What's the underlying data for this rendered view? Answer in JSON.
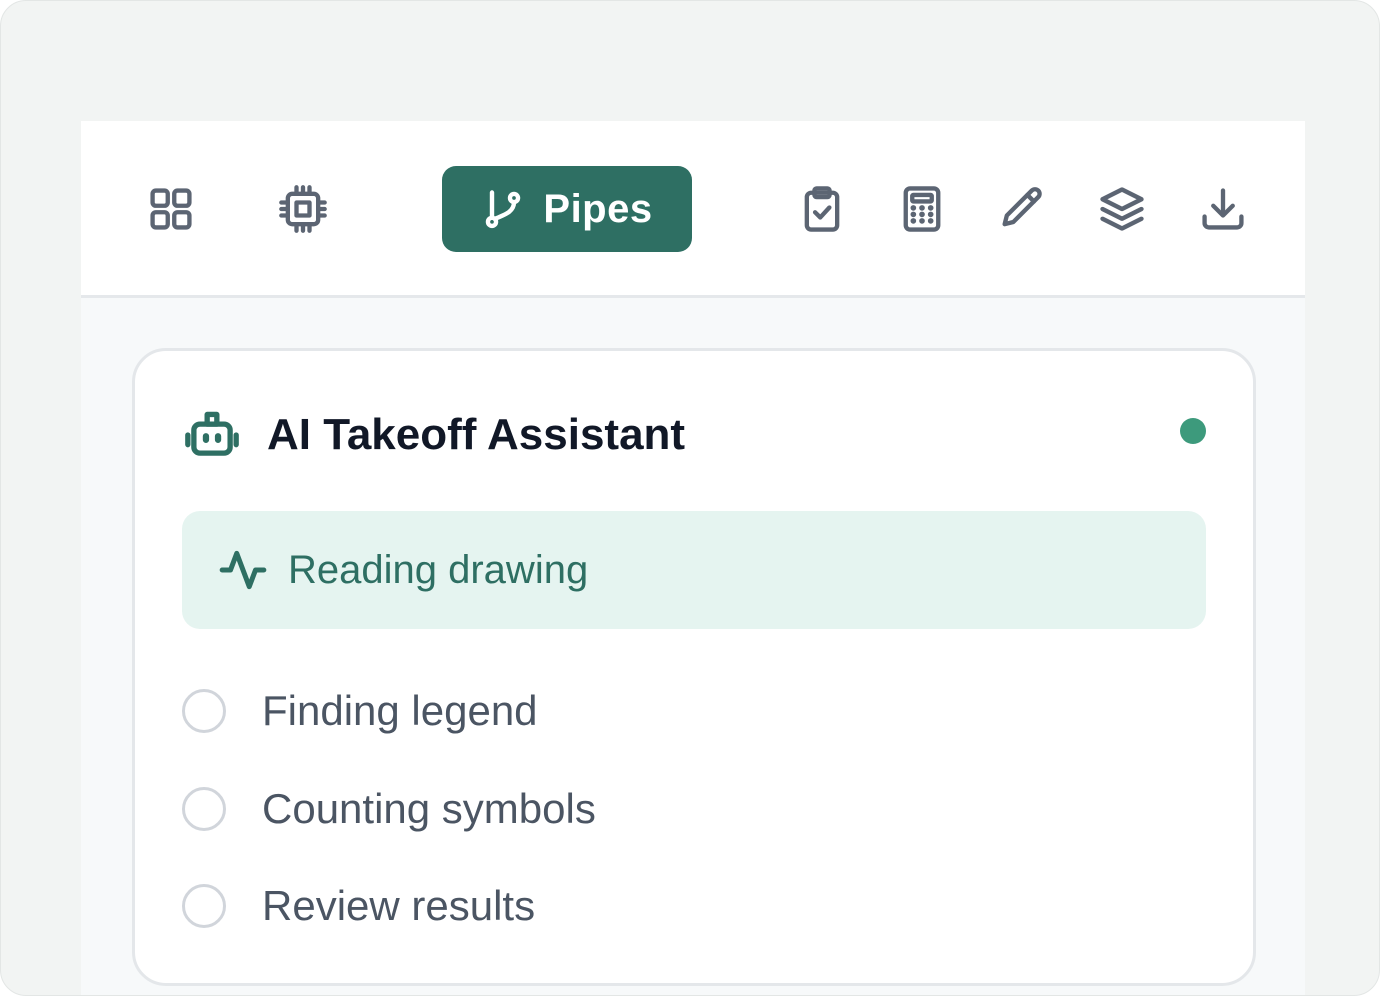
{
  "toolbar": {
    "icons": [
      "grid-icon",
      "chip-icon",
      "pipes-icon",
      "clipboard-check-icon",
      "calculator-icon",
      "pencil-icon",
      "layers-icon",
      "download-icon"
    ],
    "active_tab_label": "Pipes",
    "accent_color": "#2e6f63",
    "icon_color": "#5c6573"
  },
  "assistant": {
    "icon": "robot-icon",
    "title": "AI Takeoff Assistant",
    "status_color": "#3d9a7c",
    "active_step": {
      "icon": "activity-icon",
      "label": "Reading drawing"
    },
    "steps": [
      {
        "label": "Finding legend"
      },
      {
        "label": "Counting symbols"
      },
      {
        "label": "Review results"
      }
    ]
  }
}
